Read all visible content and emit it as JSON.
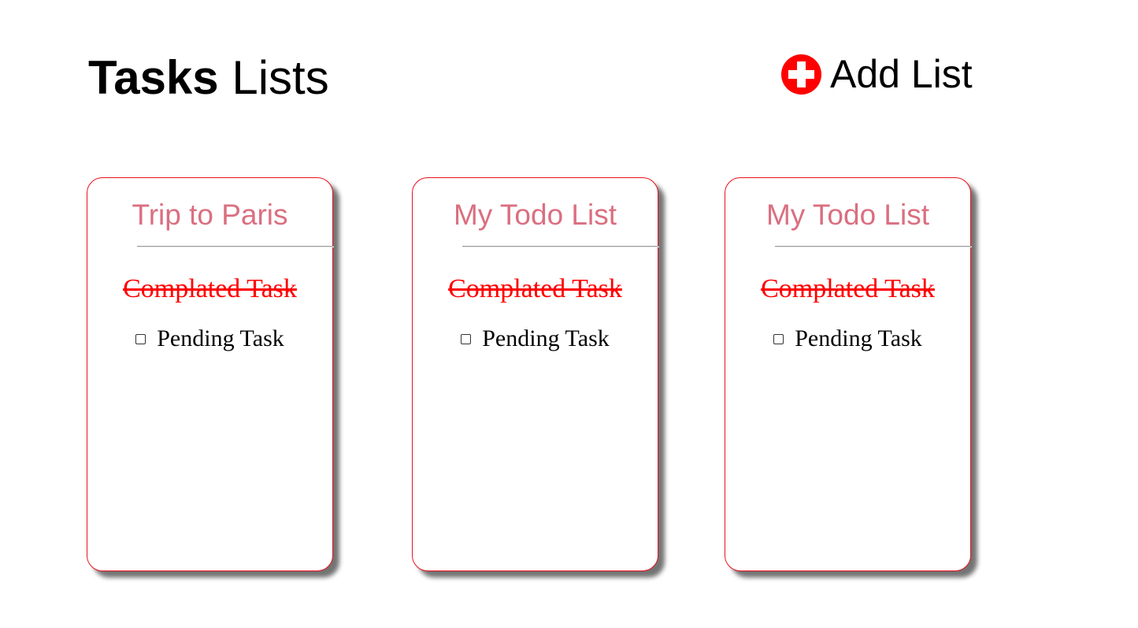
{
  "header": {
    "title_bold": "Tasks",
    "title_rest": " Lists",
    "add_list_label": "Add List",
    "add_icon": "plus-circle-icon"
  },
  "colors": {
    "card_border": "#e8121f",
    "card_title": "#da6f80",
    "completed_task": "#ff0000",
    "add_icon": "#ff0000"
  },
  "lists": [
    {
      "title": "Trip to Paris",
      "completed_task": "Complated Task",
      "pending_task": "Pending Task",
      "pending_checked": false
    },
    {
      "title": "My Todo List",
      "completed_task": "Complated Task",
      "pending_task": "Pending Task",
      "pending_checked": false
    },
    {
      "title": "My Todo List",
      "completed_task": "Complated Task",
      "pending_task": "Pending Task",
      "pending_checked": false
    }
  ]
}
